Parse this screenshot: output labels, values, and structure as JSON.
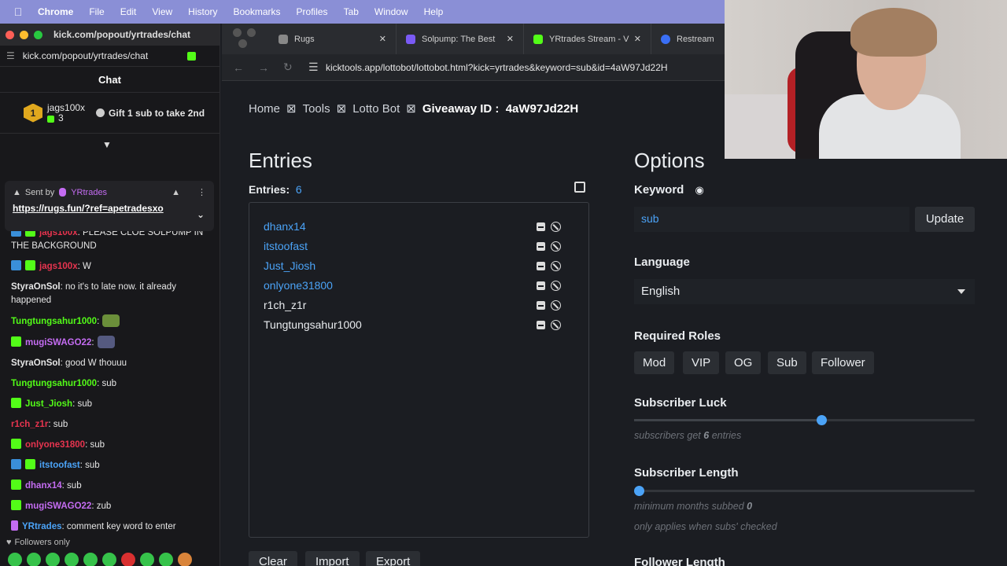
{
  "menubar": {
    "app": "Chrome",
    "items": [
      "File",
      "Edit",
      "View",
      "History",
      "Bookmarks",
      "Profiles",
      "Tab",
      "Window",
      "Help"
    ]
  },
  "chat": {
    "window_title": "kick.com/popout/yrtrades/chat",
    "url": "kick.com/popout/yrtrades/chat",
    "header": "Chat",
    "rank": "1",
    "top_user": "jags100x",
    "top_count": "3",
    "gift_text": "Gift 1 sub to take 2nd",
    "pinned_sent_by": "Sent by",
    "pinned_user": "YRtrades",
    "pinned_link": "https://rugs.fun/?ref=apetradesxo",
    "messages": [
      {
        "user": "jags100x",
        "color": "#e8344f",
        "text": ": PLEASE CLOE SOLPUMP IN THE BACKGROUND"
      },
      {
        "user": "jags100x",
        "color": "#e8344f",
        "text": ": W"
      },
      {
        "user": "StyraOnSol",
        "color": "#e6e6e6",
        "text": ": no it's to late now. it already happened"
      },
      {
        "user": "Tungtungsahur1000",
        "color": "#53fc18",
        "text": ":"
      },
      {
        "user": "mugiSWAGO22",
        "color": "#c46cf2",
        "text": ":"
      },
      {
        "user": "StyraOnSol",
        "color": "#e6e6e6",
        "text": ": good W thouuu"
      },
      {
        "user": "Tungtungsahur1000",
        "color": "#53fc18",
        "text": ": sub"
      },
      {
        "user": "Just_Jiosh",
        "color": "#53fc18",
        "text": ": sub"
      },
      {
        "user": "r1ch_z1r",
        "color": "#e8344f",
        "text": ": sub"
      },
      {
        "user": "onlyone31800",
        "color": "#e8344f",
        "text": ": sub"
      },
      {
        "user": "itstoofast",
        "color": "#4ba3f7",
        "text": ": sub"
      },
      {
        "user": "dhanx14",
        "color": "#c46cf2",
        "text": ": sub"
      },
      {
        "user": "mugiSWAGO22",
        "color": "#c46cf2",
        "text": ": zub"
      },
      {
        "user": "YRtrades",
        "color": "#4ba3f7",
        "text": ": comment key word to enter giveaway"
      }
    ],
    "followers_only": "Followers only"
  },
  "browser": {
    "tabs": [
      {
        "label": "Rugs",
        "icon": "rugs-icon"
      },
      {
        "label": "Solpump: The Best",
        "icon": "solpump-icon"
      },
      {
        "label": "YRtrades Stream - V",
        "icon": "kick-icon"
      },
      {
        "label": "Restream",
        "icon": "restream-icon"
      }
    ],
    "url": "kicktools.app/lottobot/lottobot.html?kick=yrtrades&keyword=sub&id=4aW97Jd22H"
  },
  "page": {
    "breadcrumb": {
      "home": "Home",
      "tools": "Tools",
      "lotto": "Lotto Bot",
      "giveaway_label": "Giveaway ID :",
      "giveaway_id": "4aW97Jd22H",
      "sep": "⊠"
    },
    "entries_title": "Entries",
    "entries_label": "Entries:",
    "entries_count": "6",
    "entries": [
      {
        "name": "dhanx14",
        "color": "#4ba3f7"
      },
      {
        "name": "itstoofast",
        "color": "#4ba3f7"
      },
      {
        "name": "Just_Jiosh",
        "color": "#4ba3f7"
      },
      {
        "name": "onlyone31800",
        "color": "#4ba3f7"
      },
      {
        "name": "r1ch_z1r",
        "color": "#e9ecef"
      },
      {
        "name": "Tungtungsahur1000",
        "color": "#e9ecef"
      }
    ],
    "buttons": {
      "clear": "Clear",
      "import": "Import",
      "export": "Export"
    },
    "options_title": "Options",
    "keyword_label": "Keyword",
    "keyword_value": "sub",
    "update": "Update",
    "language_label": "Language",
    "language_value": "English",
    "roles_label": "Required Roles",
    "roles": [
      "Mod",
      "VIP",
      "OG",
      "Sub",
      "Follower"
    ],
    "luck_label": "Subscriber Luck",
    "luck_value": 0.55,
    "luck_hint_pre": "subscribers get",
    "luck_hint_num": "6",
    "luck_hint_post": "entries",
    "length_label": "Subscriber Length",
    "length_value": 0,
    "length_hint_pre": "minimum months subbed",
    "length_hint_num": "0",
    "length_hint2": "only applies when subs' checked",
    "follower_length_label": "Follower Length"
  },
  "colors": {
    "accent": "#4ba3f7",
    "kick_green": "#53fc18",
    "menubar": "#8a8fd6"
  }
}
